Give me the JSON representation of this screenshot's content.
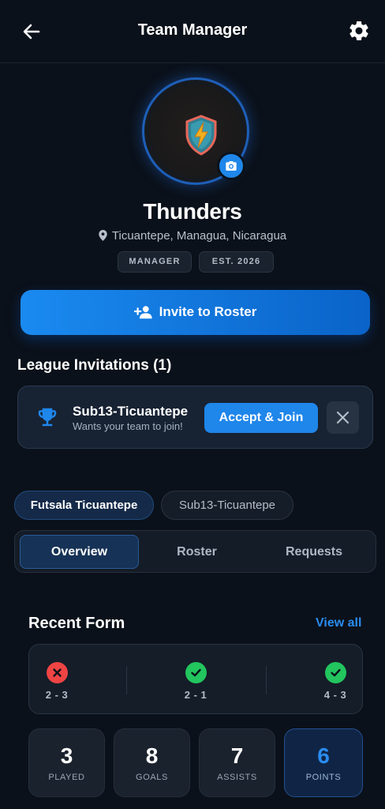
{
  "header": {
    "title": "Team Manager",
    "back_icon": "back-arrow-icon",
    "settings_icon": "gear-icon"
  },
  "team": {
    "name": "Thunders",
    "location": "Ticuantepe, Managua, Nicaragua",
    "badges": [
      "MANAGER",
      "EST. 2026"
    ],
    "logo_icon": "lightning-shield-icon"
  },
  "invite_button": {
    "label": "Invite to Roster",
    "icon": "add-person-icon"
  },
  "league_invitations": {
    "title": "League Invitations (1)",
    "items": [
      {
        "league": "Sub13-Ticuantepe",
        "message": "Wants your team to join!",
        "accept_label": "Accept & Join",
        "icon": "trophy-icon"
      }
    ]
  },
  "league_tabs": [
    "Futsala Ticuantepe",
    "Sub13-Ticuantepe"
  ],
  "active_league_tab": "Futsala Ticuantepe",
  "view_tabs": [
    "Overview",
    "Roster",
    "Requests"
  ],
  "active_view_tab": "Overview",
  "recent_form": {
    "title": "Recent Form",
    "view_all_label": "View all",
    "results": [
      {
        "result": "loss",
        "score": "2 - 3"
      },
      {
        "result": "win",
        "score": "2 - 1"
      },
      {
        "result": "win",
        "score": "4 - 3"
      }
    ]
  },
  "stats": [
    {
      "value": "3",
      "label": "PLAYED"
    },
    {
      "value": "8",
      "label": "GOALS"
    },
    {
      "value": "7",
      "label": "ASSISTS"
    },
    {
      "value": "6",
      "label": "POINTS"
    }
  ],
  "colors": {
    "background": "#0b111a",
    "accent": "#1f86ea",
    "win": "#22c55e",
    "loss": "#ef4444"
  }
}
